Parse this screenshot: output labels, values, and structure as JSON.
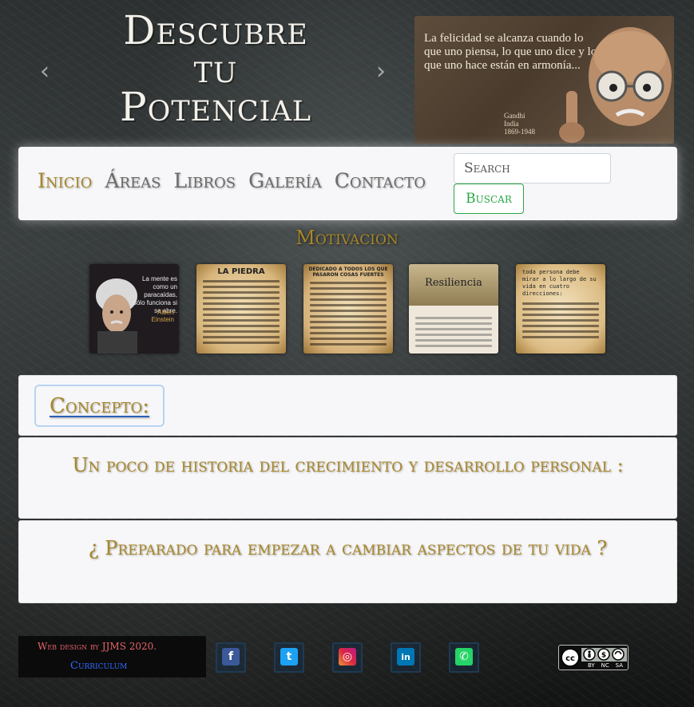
{
  "hero": {
    "title_line1": "Descubre",
    "title_line2": "tu",
    "title_line3": "Potencial",
    "prev_glyph": "‹",
    "next_glyph": "›",
    "quote": "La felicidad se alcanza cuando lo que uno piensa, lo que uno dice y lo que uno hace están en armonía...",
    "quote_author": "Gandhi",
    "quote_origin": "India",
    "quote_years": "1869-1948"
  },
  "nav": {
    "items": [
      "Inicio",
      "Áreas",
      "Libros",
      "Galería",
      "Contacto"
    ],
    "search_placeholder": "Search",
    "search_button": "Buscar"
  },
  "gallery": {
    "heading": "Motivacion",
    "items": [
      {
        "icon": "einstein-portrait",
        "text": "La mente es como un paracaídas, sólo funciona si se abre.",
        "author": "Albert Einstein"
      },
      {
        "icon": "parchment-text",
        "title": "LA PIEDRA"
      },
      {
        "icon": "parchment-text",
        "title": "DEDICADO A TODOS LOS QUE PASARON COSAS FUERTES"
      },
      {
        "icon": "parchment-text",
        "title": "Resiliencia"
      },
      {
        "icon": "parchment-text",
        "title": "toda persona debe mirar a lo largo de su vida en cuatro direcciones:"
      }
    ]
  },
  "cards": {
    "concept_button": "Concepto:",
    "history_heading": "Un poco de historia del crecimiento y desarrollo personal :",
    "ready_heading": "¿ Preparado para empezar a cambiar aspectos de tu vida ?"
  },
  "footer": {
    "credit": "Web design by JJMS 2020.",
    "cv_link": "Curriculum",
    "social": [
      {
        "icon": "facebook-icon",
        "glyph": "f",
        "color": "#3b5998"
      },
      {
        "icon": "twitter-icon",
        "glyph": "t",
        "color": "#1da1f2"
      },
      {
        "icon": "instagram-icon",
        "glyph": "◎",
        "color": "#c13584"
      },
      {
        "icon": "linkedin-icon",
        "glyph": "in",
        "color": "#0077b5"
      },
      {
        "icon": "whatsapp-icon",
        "glyph": "✆",
        "color": "#25d366"
      }
    ],
    "license_labels": [
      "BY",
      "NC",
      "SA"
    ]
  },
  "colors": {
    "accent_gold": "#a88729",
    "nav_gray": "#6b6b6b",
    "button_green": "#28a745",
    "link_blue": "#2f6cff",
    "credit_red": "#e6636a"
  }
}
